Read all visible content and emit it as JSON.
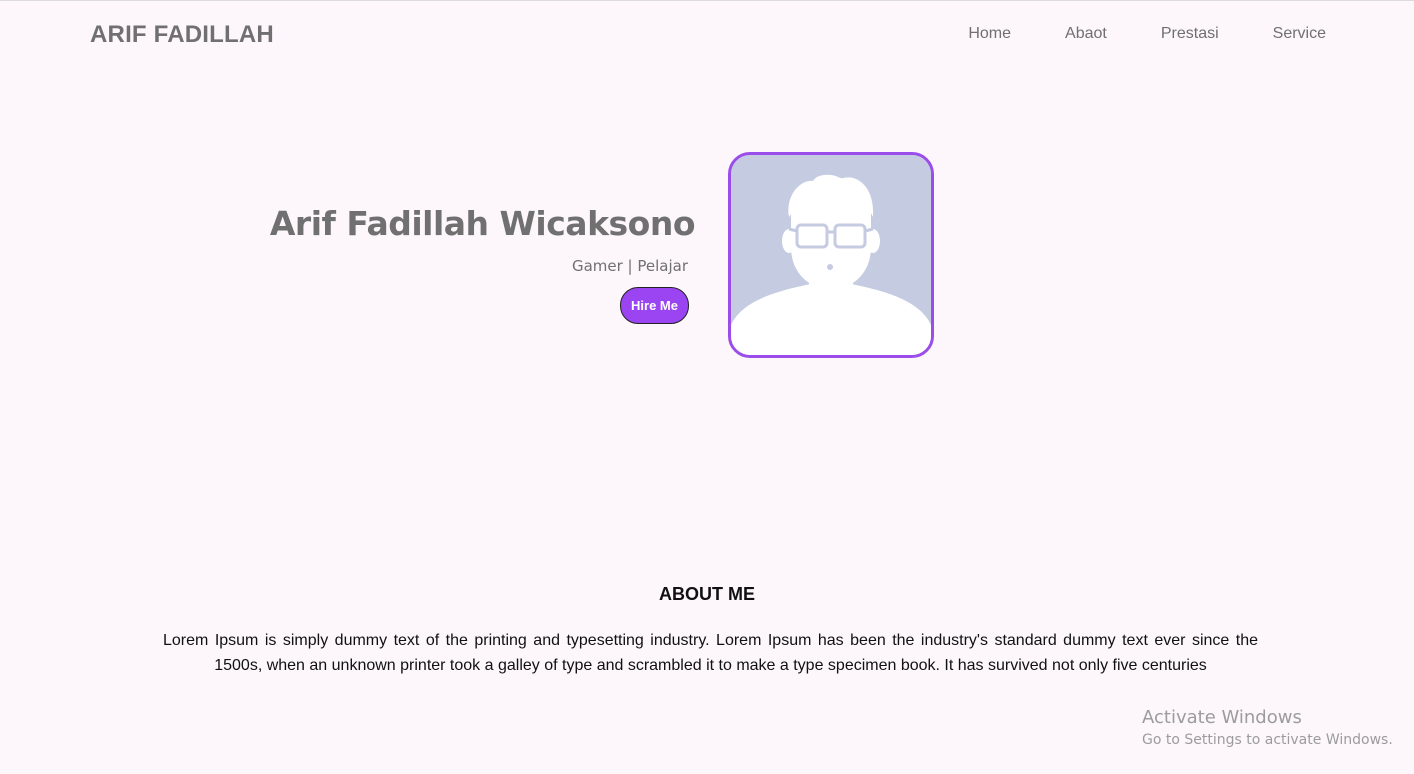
{
  "header": {
    "brand": "ARIF FADILLAH",
    "nav": [
      "Home",
      "Abaot",
      "Prestasi",
      "Service"
    ]
  },
  "hero": {
    "name": "Arif Fadillah Wicaksono",
    "role": "Gamer | Pelajar",
    "cta_label": "Hire Me"
  },
  "about": {
    "title": "ABOUT ME",
    "text": "Lorem Ipsum is simply dummy text of the printing and typesetting industry. Lorem Ipsum has been the industry's standard dummy text ever since the 1500s, when an unknown printer took a galley of type and scrambled it to make a type specimen book. It has survived not only five centuries"
  },
  "overlay": {
    "activate_title": "Activate Windows",
    "activate_sub": "Go to Settings to activate Windows."
  },
  "colors": {
    "background": "#fdf7fc",
    "accent": "#9b44f2",
    "avatar_border": "#9b4dea",
    "avatar_bg": "#c5cbe1",
    "muted_text": "#707070"
  },
  "icons": {
    "avatar": "default-user-avatar-icon"
  }
}
